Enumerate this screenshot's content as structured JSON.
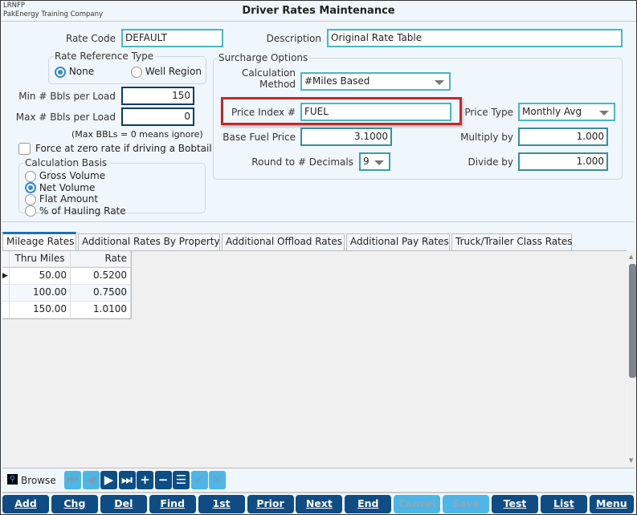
{
  "header": {
    "app_code": "LRNFP",
    "company": "PakEnergy Training Company",
    "title": "Driver Rates Maintenance"
  },
  "form": {
    "rate_code_label": "Rate Code",
    "rate_code": "DEFAULT",
    "description_label": "Description",
    "description": "Original Rate Table",
    "rate_ref_type": {
      "title": "Rate Reference Type",
      "options": [
        "None",
        "Well Region"
      ],
      "selected": "None"
    },
    "min_bbls_label": "Min # Bbls per Load",
    "min_bbls": "150",
    "max_bbls_label": "Max # Bbls per Load",
    "max_bbls": "0",
    "max_note": "(Max BBLs = 0 means ignore)",
    "bobtail_label": "Force at zero rate if driving a Bobtail",
    "bobtail_checked": false,
    "calc_basis": {
      "title": "Calculation Basis",
      "options": [
        "Gross Volume",
        "Net Volume",
        "Flat Amount",
        "% of Hauling Rate"
      ],
      "selected": "Net Volume"
    },
    "surcharge": {
      "title": "Surcharge Options",
      "calc_method_label1": "Calculation",
      "calc_method_label2": "Method",
      "calc_method": "#Miles Based",
      "price_index_label": "Price Index #",
      "price_index": "FUEL",
      "price_type_label": "Price Type",
      "price_type": "Monthly Avg",
      "base_fuel_label": "Base Fuel Price",
      "base_fuel": "3.1000",
      "multiply_label": "Multiply by",
      "multiply": "1.000",
      "round_label": "Round to # Decimals",
      "round": "9",
      "divide_label": "Divide by",
      "divide": "1.000"
    },
    "highlight_color": "#c0282d"
  },
  "tabs": [
    "Mileage Rates",
    "Additional Rates By Property",
    "Additional Offload Rates",
    "Additional Pay Rates",
    "Truck/Trailer Class Rates"
  ],
  "active_tab": "Mileage Rates",
  "grid": {
    "columns": [
      "Thru Miles",
      "Rate"
    ],
    "rows": [
      [
        "50.00",
        "0.5200"
      ],
      [
        "100.00",
        "0.7500"
      ],
      [
        "150.00",
        "1.0100"
      ]
    ]
  },
  "browse": {
    "label": "Browse",
    "nav": [
      "first",
      "prior",
      "next",
      "last",
      "add",
      "delete",
      "detail",
      "confirm",
      "cancel"
    ]
  },
  "buttons": [
    {
      "label": "Add",
      "enabled": true
    },
    {
      "label": "Chg",
      "enabled": true
    },
    {
      "label": "Del",
      "enabled": true
    },
    {
      "label": "Find",
      "enabled": true
    },
    {
      "label": "1st",
      "enabled": true
    },
    {
      "label": "Prior",
      "enabled": true
    },
    {
      "label": "Next",
      "enabled": true
    },
    {
      "label": "End",
      "enabled": true
    },
    {
      "label": "Cancel",
      "enabled": false
    },
    {
      "label": "Save",
      "enabled": false
    },
    {
      "label": "Test",
      "enabled": true
    },
    {
      "label": "List",
      "enabled": true
    },
    {
      "label": "Menu",
      "enabled": true
    }
  ],
  "colors": {
    "accent": "#0f4c84",
    "disabled": "#4cb6e8",
    "field_border": "#46b8c0"
  }
}
